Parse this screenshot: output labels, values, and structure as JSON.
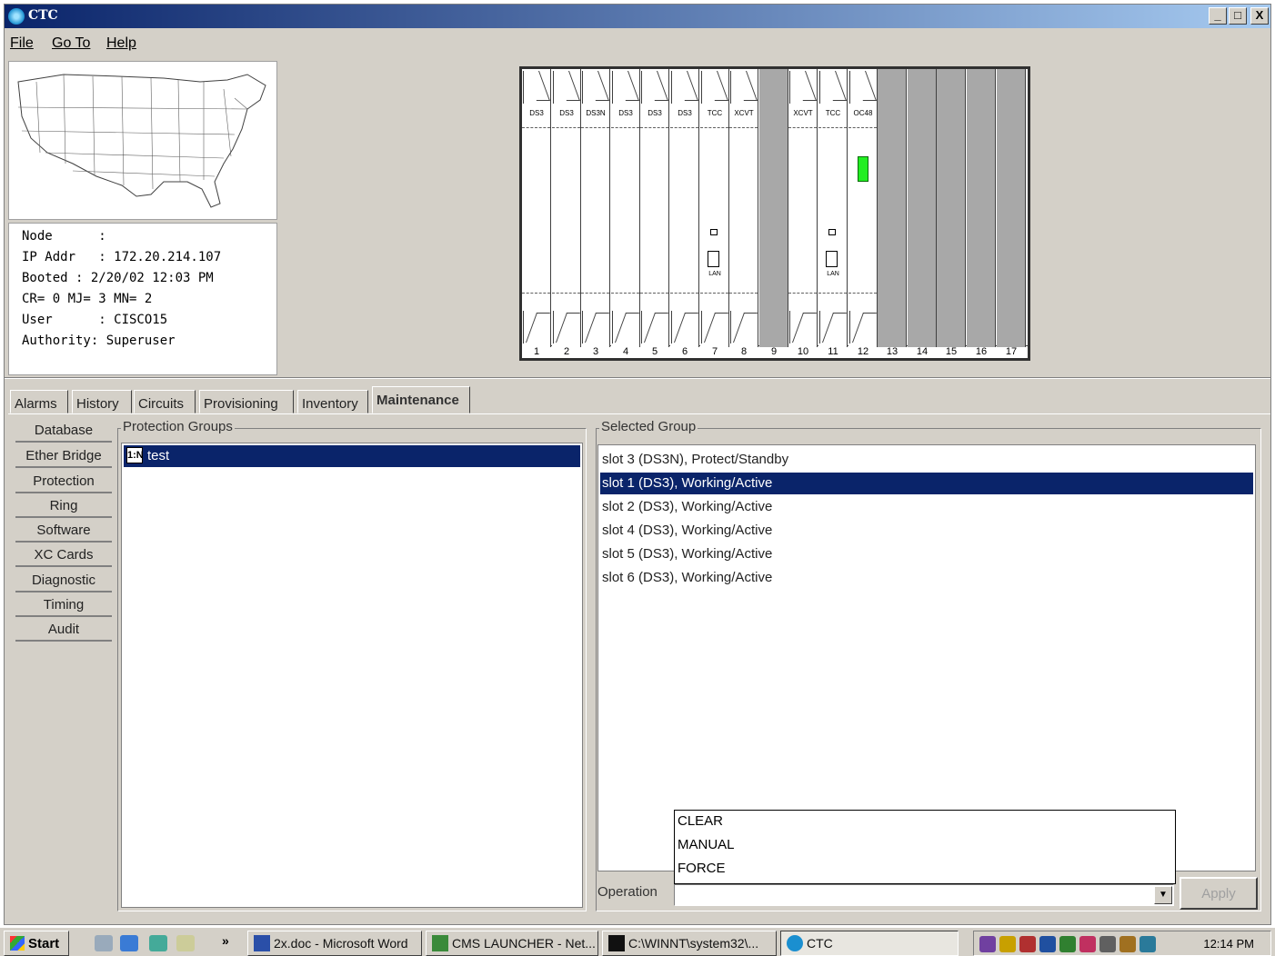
{
  "window": {
    "title": "CTC",
    "minimize": "_",
    "maximize": "□",
    "close": "X"
  },
  "menu": {
    "file": "File",
    "goto": "Go To",
    "help": "Help"
  },
  "node_info": {
    "node": "Node      :",
    "ip": "IP Addr   : 172.20.214.107",
    "booted": "Booted : 2/20/02 12:03 PM",
    "alarms": "CR= 0 MJ= 3 MN= 2",
    "user": "User      : CISCO15",
    "authority": "Authority: Superuser"
  },
  "shelf": {
    "slots": [
      {
        "num": "1",
        "label": "DS3"
      },
      {
        "num": "2",
        "label": "DS3"
      },
      {
        "num": "3",
        "label": "DS3N"
      },
      {
        "num": "4",
        "label": "DS3"
      },
      {
        "num": "5",
        "label": "DS3"
      },
      {
        "num": "6",
        "label": "DS3"
      },
      {
        "num": "7",
        "label": "TCC"
      },
      {
        "num": "8",
        "label": "XCVT"
      },
      {
        "num": "9",
        "label": ""
      },
      {
        "num": "10",
        "label": "XCVT"
      },
      {
        "num": "11",
        "label": "TCC"
      },
      {
        "num": "12",
        "label": "OC48"
      },
      {
        "num": "13",
        "label": ""
      },
      {
        "num": "14",
        "label": ""
      },
      {
        "num": "15",
        "label": ""
      },
      {
        "num": "16",
        "label": ""
      },
      {
        "num": "17",
        "label": ""
      }
    ],
    "lan_label": "LAN"
  },
  "tabs": [
    "Alarms",
    "History",
    "Circuits",
    "Provisioning",
    "Inventory",
    "Maintenance"
  ],
  "active_tab": "Maintenance",
  "sidebar": [
    "Database",
    "Ether Bridge",
    "Protection",
    "Ring",
    "Software",
    "XC Cards",
    "Diagnostic",
    "Timing",
    "Audit"
  ],
  "protection_groups": {
    "title": "Protection Groups",
    "items": [
      {
        "icon": "1:N",
        "name": "test"
      }
    ]
  },
  "selected_group": {
    "title": "Selected Group",
    "items": [
      "slot  3 (DS3N), Protect/Standby",
      "slot  1 (DS3), Working/Active",
      "slot  2 (DS3), Working/Active",
      "slot  4 (DS3), Working/Active",
      "slot  5 (DS3), Working/Active",
      "slot  6 (DS3), Working/Active"
    ],
    "selected_index": 1
  },
  "operation": {
    "label": "Operation",
    "options": [
      "CLEAR",
      "MANUAL",
      "FORCE"
    ],
    "value": "",
    "apply": "Apply"
  },
  "taskbar": {
    "start": "Start",
    "overflow": "»",
    "tasks": [
      "2x.doc - Microsoft Word",
      "CMS LAUNCHER - Net...",
      "C:\\WINNT\\system32\\...",
      "CTC"
    ],
    "clock": "12:14 PM"
  },
  "colors": {
    "selection": "#0a246a",
    "face": "#d4d0c8",
    "led": "#22ee22"
  }
}
